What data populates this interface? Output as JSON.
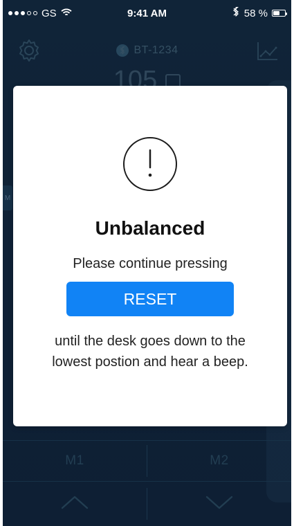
{
  "status_bar": {
    "carrier": "GS",
    "signal_strength": 3,
    "time": "9:41 AM",
    "battery_text": "58 %",
    "battery_level": 0.58,
    "icons": {
      "wifi": "wifi-icon",
      "bluetooth": "bluetooth-icon",
      "battery": "battery-icon"
    }
  },
  "app": {
    "device_name": "BT-1234",
    "height_value": "105",
    "side_tab_label": "M",
    "memory_buttons": [
      "M1",
      "M2"
    ],
    "icons": {
      "settings": "gear-icon",
      "history": "line-chart-icon",
      "connection": "bluetooth-icon",
      "up": "chevron-up-icon",
      "down": "chevron-down-icon"
    }
  },
  "modal": {
    "icon": "alert-circle-icon",
    "title": "Unbalanced",
    "line1": "Please continue pressing",
    "button_label": "RESET",
    "line2": "until the desk goes down to the",
    "line3": "lowest postion and hear a beep."
  },
  "colors": {
    "app_background": "#11263a",
    "modal_background": "#ffffff",
    "primary_button": "#1183f5"
  }
}
